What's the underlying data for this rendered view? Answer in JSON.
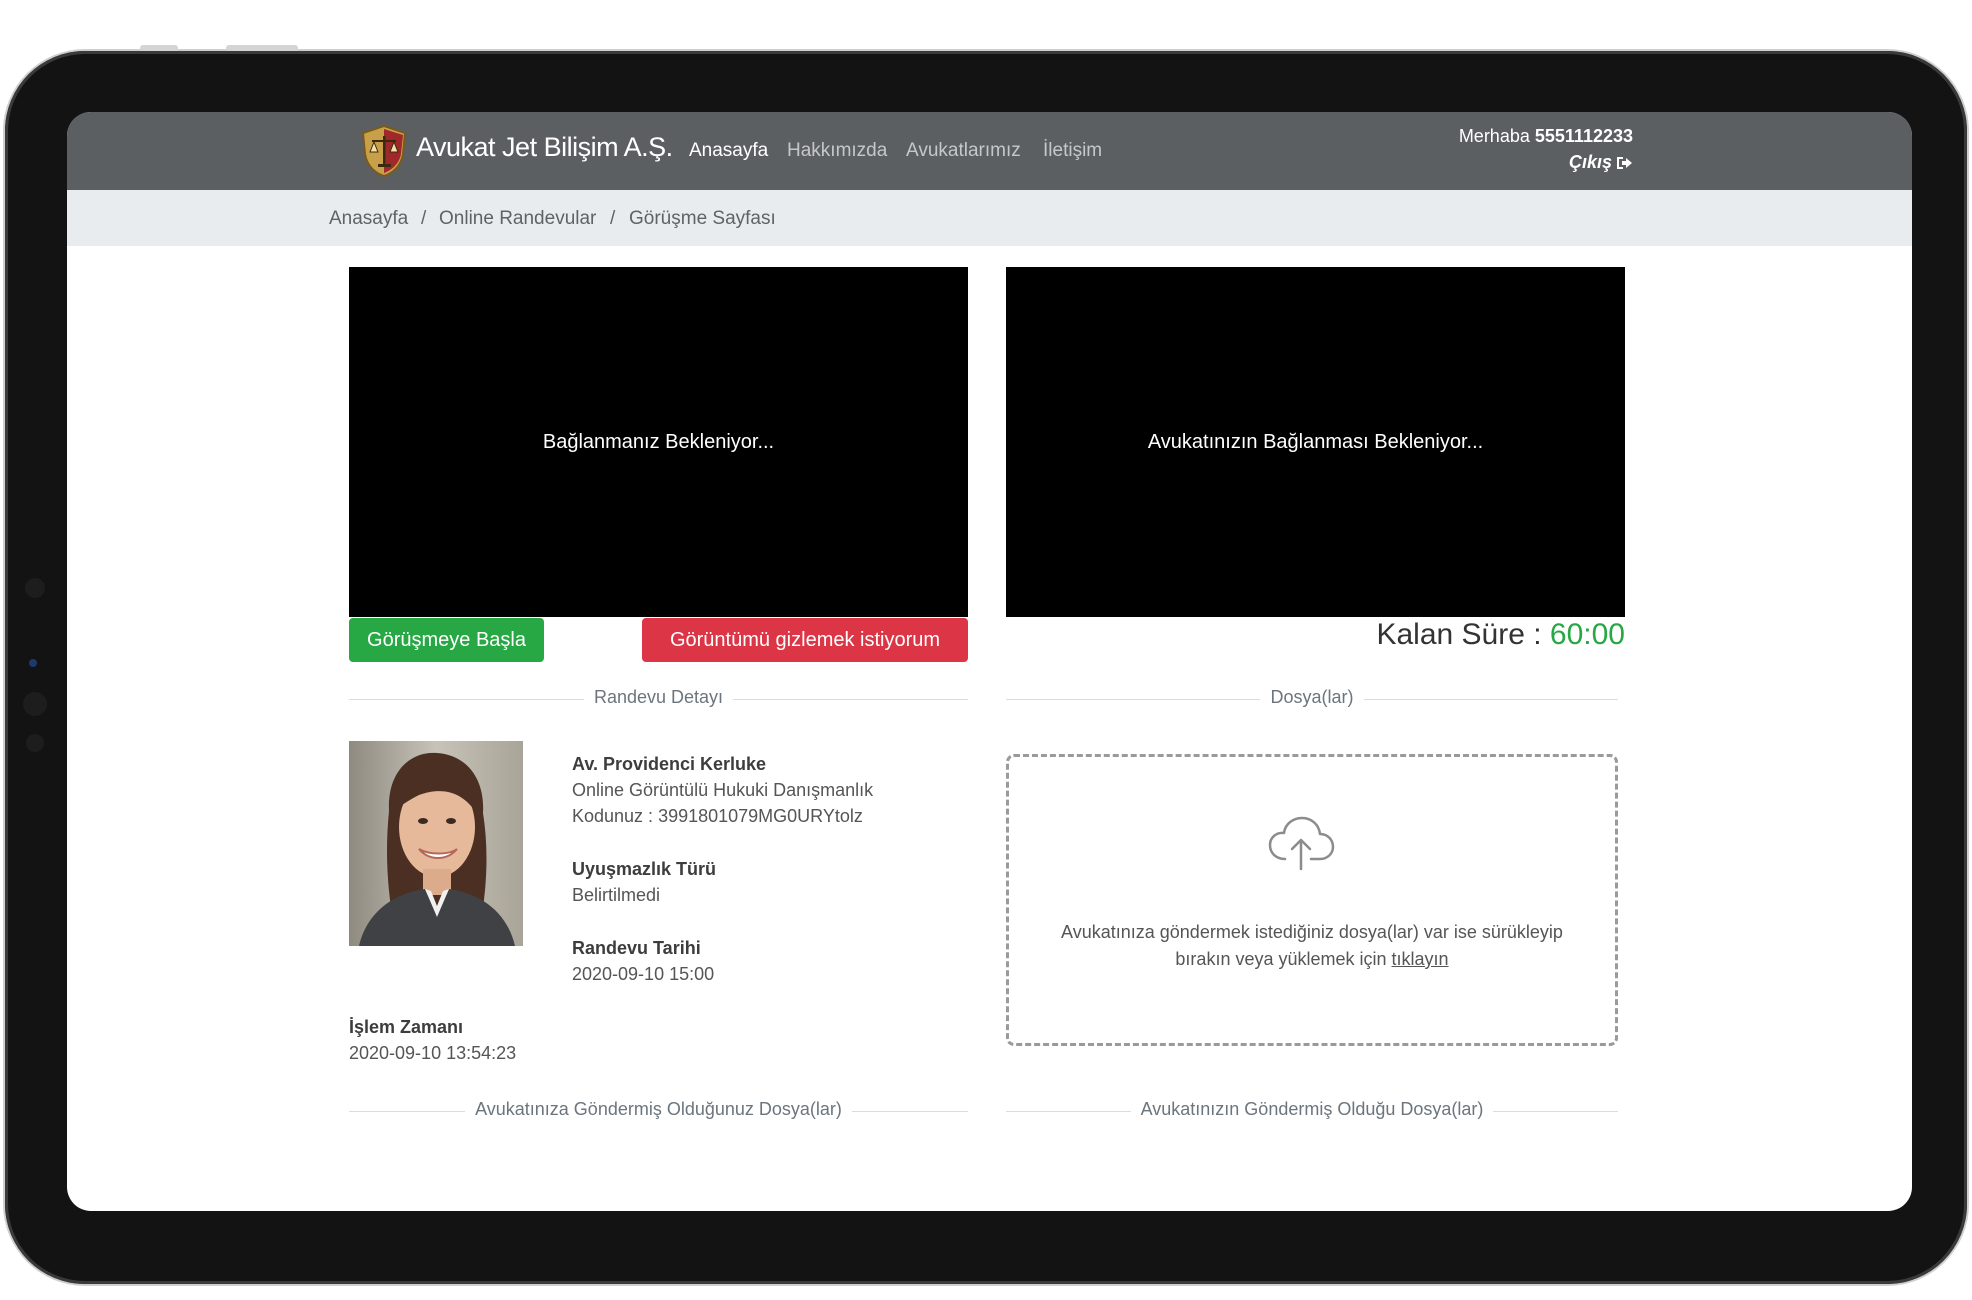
{
  "navbar": {
    "brand": "Avukat Jet Bilişim A.Ş.",
    "items": [
      {
        "label": "Anasayfa",
        "active": true
      },
      {
        "label": "Hakkımızda",
        "active": false
      },
      {
        "label": "Avukatlarımız",
        "active": false
      },
      {
        "label": "İletişim",
        "active": false
      }
    ],
    "greeting": "Merhaba",
    "username": "5551112233",
    "logout_label": "Çıkış"
  },
  "breadcrumb": [
    "Anasayfa",
    "Online Randevular",
    "Görüşme Sayfası"
  ],
  "video": {
    "self_status": "Bağlanmanız Bekleniyor...",
    "lawyer_status": "Avukatınızın Bağlanması Bekleniyor..."
  },
  "actions": {
    "start_label": "Görüşmeye Başla",
    "hide_label": "Görüntümü gizlemek istiyorum"
  },
  "timer": {
    "label": "Kalan Süre :",
    "value": "60:00"
  },
  "sections": {
    "appointment_detail": "Randevu Detayı",
    "files": "Dosya(lar)",
    "sent_files": "Avukatınıza Göndermiş Olduğunuz Dosya(lar)",
    "received_files": "Avukatınızın Göndermiş Olduğu Dosya(lar)"
  },
  "appointment": {
    "lawyer_name": "Av. Providenci Kerluke",
    "service": "Online Görüntülü Hukuki Danışmanlık",
    "code": "Kodunuz : 3991801079MG0URYtolz",
    "dispute_type_label": "Uyuşmazlık Türü",
    "dispute_type_value": "Belirtilmedi",
    "date_label": "Randevu Tarihi",
    "date_value": "2020-09-10 15:00",
    "process_time_label": "İşlem Zamanı",
    "process_time_value": "2020-09-10 13:54:23"
  },
  "upload": {
    "text_line1": "Avukatınıza göndermek istediğiniz dosya(lar) var ise sürükleyip",
    "text_line2": "bırakın veya yüklemek için",
    "link_label": "tıklayın"
  },
  "colors": {
    "navbar_bg": "#5c5f62",
    "breadcrumb_bg": "#e9ecef",
    "start_button": "#28a745",
    "hide_button": "#dc3545",
    "timer_value": "#28a745"
  },
  "icons": {
    "logo": "scales-shield-icon",
    "logout": "sign-out-icon",
    "upload": "cloud-upload-icon"
  }
}
